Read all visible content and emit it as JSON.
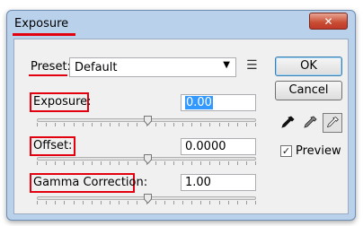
{
  "window": {
    "title": "Exposure",
    "close_glyph": "✕"
  },
  "preset": {
    "label": "Preset:",
    "value": "Default",
    "menu_icon": "list-options-icon"
  },
  "controls": [
    {
      "label": "Exposure:",
      "value": "0.00",
      "slider_fraction": 0.5
    },
    {
      "label": "Offset:",
      "value": "0.0000",
      "slider_fraction": 0.5
    },
    {
      "label": "Gamma Correction:",
      "value": "1.00",
      "slider_fraction": 0.5
    }
  ],
  "buttons": {
    "ok": "OK",
    "cancel": "Cancel"
  },
  "eyedroppers": [
    "black-point-eyedropper-icon",
    "gray-point-eyedropper-icon",
    "white-point-eyedropper-icon"
  ],
  "preview": {
    "label": "Preview",
    "checked": true
  },
  "colors": {
    "annotation_red": "#e3000f",
    "selection_blue": "#3399ff",
    "title_bar": "#b9d1ea",
    "close_red": "#c84c32"
  }
}
